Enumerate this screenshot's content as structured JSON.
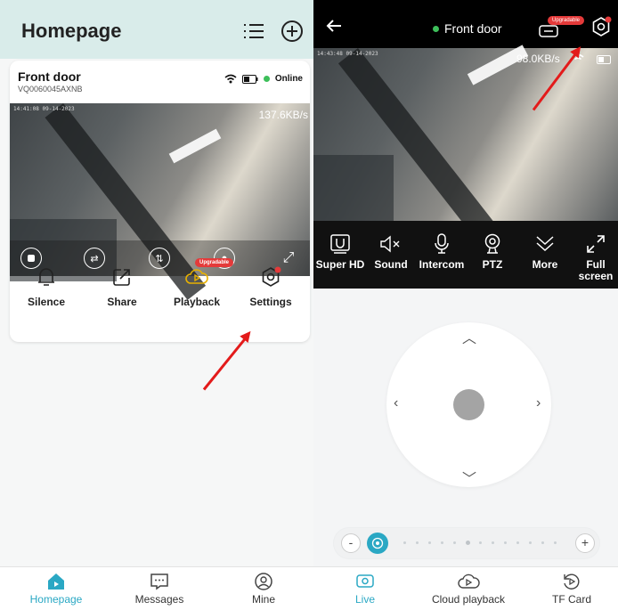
{
  "left": {
    "header": {
      "title": "Homepage"
    },
    "device": {
      "name": "Front door",
      "id": "VQ0060045AXNB",
      "status": "Online",
      "timestamp": "14:41:08 09-14-2023",
      "bitrate": "137.6KB/s"
    },
    "actions": [
      {
        "label": "Silence",
        "icon": "bell-icon"
      },
      {
        "label": "Share",
        "icon": "share-icon"
      },
      {
        "label": "Playback",
        "icon": "cloud-playback-icon",
        "badge": "Upgradable"
      },
      {
        "label": "Settings",
        "icon": "settings-icon"
      }
    ],
    "tabs": [
      {
        "label": "Homepage",
        "active": true
      },
      {
        "label": "Messages"
      },
      {
        "label": "Mine"
      }
    ]
  },
  "right": {
    "title": "Front door",
    "badge": "Upgradable",
    "timestamp": "14:43:48 09-14-2023",
    "bitrate": "98.0KB/s",
    "tools": [
      {
        "label": "Super HD",
        "icon": "hd-icon"
      },
      {
        "label": "Sound",
        "icon": "mute-icon"
      },
      {
        "label": "Intercom",
        "icon": "microphone-icon"
      },
      {
        "label": "PTZ",
        "icon": "ptz-camera-icon"
      },
      {
        "label": "More",
        "icon": "chevrons-down-icon"
      },
      {
        "label": "Full screen",
        "icon": "fullscreen-icon"
      }
    ],
    "zoom": {
      "minus": "-",
      "plus": "+"
    },
    "tabs": [
      {
        "label": "Live",
        "active": true
      },
      {
        "label": "Cloud playback"
      },
      {
        "label": "TF Card"
      }
    ]
  },
  "colors": {
    "accent": "#2aa8c4",
    "online": "#3dbf5a",
    "badge": "#e43a3a",
    "arrow": "#e31b1b",
    "header_bg": "#d9ecea"
  }
}
